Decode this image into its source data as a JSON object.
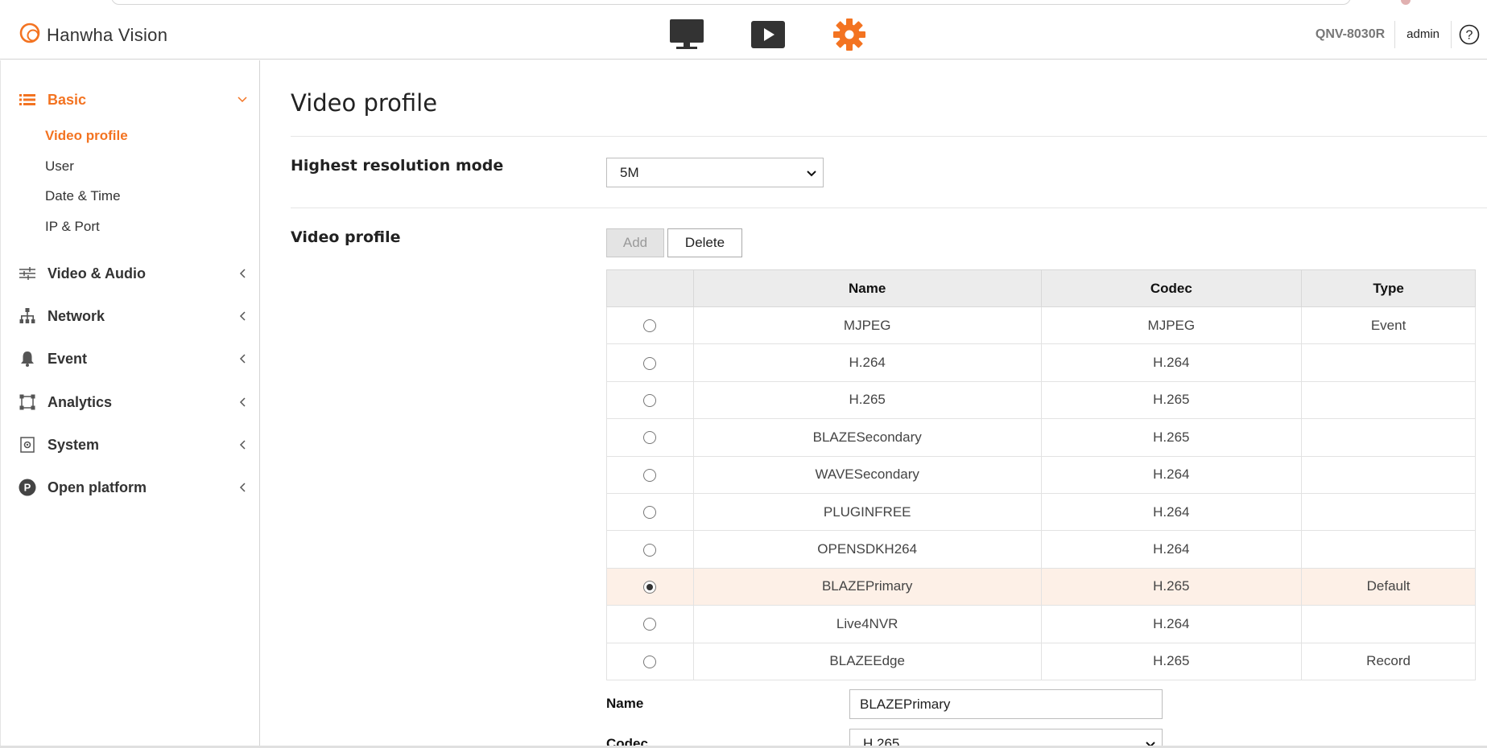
{
  "header": {
    "brand": "Hanwha Vision",
    "model": "QNV-8030R",
    "user": "admin",
    "nav_icons": [
      "monitor-icon",
      "play-icon",
      "gear-icon"
    ],
    "accent_color": "#f37321"
  },
  "sidebar": {
    "groups": [
      {
        "label": "Basic",
        "icon": "list-icon",
        "expanded": true
      },
      {
        "label": "Video & Audio",
        "icon": "sliders-icon"
      },
      {
        "label": "Network",
        "icon": "network-icon"
      },
      {
        "label": "Event",
        "icon": "bell-icon"
      },
      {
        "label": "Analytics",
        "icon": "analytics-icon"
      },
      {
        "label": "System",
        "icon": "system-icon"
      },
      {
        "label": "Open platform",
        "icon": "open-platform-icon"
      }
    ],
    "basic_items": [
      "Video profile",
      "User",
      "Date & Time",
      "IP & Port"
    ],
    "active_item": "Video profile"
  },
  "main": {
    "title": "Video profile",
    "resolution_label": "Highest resolution mode",
    "resolution_value": "5M",
    "profile_label": "Video profile",
    "add_label": "Add",
    "delete_label": "Delete",
    "table": {
      "headers": [
        "",
        "Name",
        "Codec",
        "Type"
      ],
      "rows": [
        {
          "name": "MJPEG",
          "codec": "MJPEG",
          "type": "Event",
          "selected": false
        },
        {
          "name": "H.264",
          "codec": "H.264",
          "type": "",
          "selected": false
        },
        {
          "name": "H.265",
          "codec": "H.265",
          "type": "",
          "selected": false
        },
        {
          "name": "BLAZESecondary",
          "codec": "H.265",
          "type": "",
          "selected": false
        },
        {
          "name": "WAVESecondary",
          "codec": "H.264",
          "type": "",
          "selected": false
        },
        {
          "name": "PLUGINFREE",
          "codec": "H.264",
          "type": "",
          "selected": false
        },
        {
          "name": "OPENSDKH264",
          "codec": "H.264",
          "type": "",
          "selected": false
        },
        {
          "name": "BLAZEPrimary",
          "codec": "H.265",
          "type": "Default",
          "selected": true
        },
        {
          "name": "Live4NVR",
          "codec": "H.264",
          "type": "",
          "selected": false
        },
        {
          "name": "BLAZEEdge",
          "codec": "H.265",
          "type": "Record",
          "selected": false
        }
      ]
    },
    "name_label": "Name",
    "name_value": "BLAZEPrimary",
    "codec_label": "Codec",
    "codec_value": "H.265"
  }
}
